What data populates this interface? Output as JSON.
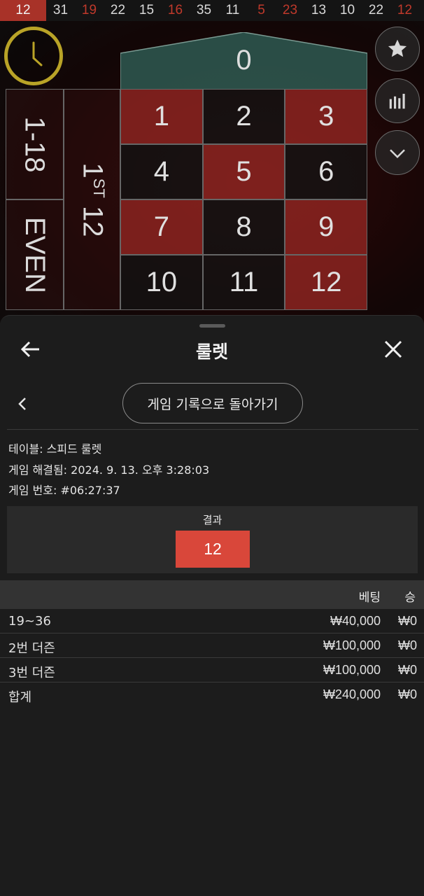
{
  "game_scene": {
    "history": [
      {
        "value": "12",
        "color": "red",
        "current": true
      },
      {
        "value": "31",
        "color": "black"
      },
      {
        "value": "19",
        "color": "red"
      },
      {
        "value": "22",
        "color": "black"
      },
      {
        "value": "15",
        "color": "black"
      },
      {
        "value": "16",
        "color": "red"
      },
      {
        "value": "35",
        "color": "black"
      },
      {
        "value": "11",
        "color": "black"
      },
      {
        "value": "5",
        "color": "red"
      },
      {
        "value": "23",
        "color": "red"
      },
      {
        "value": "13",
        "color": "black"
      },
      {
        "value": "10",
        "color": "black"
      },
      {
        "value": "22",
        "color": "black"
      },
      {
        "value": "12",
        "color": "red"
      }
    ],
    "zero_label": "0",
    "board": [
      {
        "n": "1",
        "color": "red"
      },
      {
        "n": "2",
        "color": "black"
      },
      {
        "n": "3",
        "color": "red"
      },
      {
        "n": "4",
        "color": "black"
      },
      {
        "n": "5",
        "color": "red"
      },
      {
        "n": "6",
        "color": "black"
      },
      {
        "n": "7",
        "color": "red"
      },
      {
        "n": "8",
        "color": "black"
      },
      {
        "n": "9",
        "color": "red"
      },
      {
        "n": "10",
        "color": "black"
      },
      {
        "n": "11",
        "color": "black"
      },
      {
        "n": "12",
        "color": "red"
      }
    ],
    "outside_bets": {
      "low": "1-18",
      "even": "EVEN",
      "dozen_number": "1",
      "dozen_suffix": "ST",
      "dozen_value": "12"
    },
    "side_buttons": [
      "star-icon",
      "statistics-icon",
      "chevron-down-icon"
    ],
    "colors": {
      "red": "#a83228",
      "timer": "#b9a327",
      "zero": "#2e5a52"
    }
  },
  "sheet": {
    "title": "룰렛",
    "history_button": "게임 기록으로 돌아가기",
    "table_label": "테이블:",
    "table_value": "스피드 룰렛",
    "resolved_label": "게임 해결됨:",
    "resolved_value": "2024. 9. 13. 오후 3:28:03",
    "game_id_label": "게임 번호:",
    "game_id_value": "#06:27:37",
    "result_label": "결과",
    "result_value": "12",
    "result_color": "#d9473a",
    "bets_header": {
      "bet": "베팅",
      "win": "승"
    },
    "bets": [
      {
        "name": "19~36",
        "amount": "₩40,000",
        "win": "₩0"
      },
      {
        "name": "2번 더즌",
        "amount": "₩100,000",
        "win": "₩0"
      },
      {
        "name": "3번 더즌",
        "amount": "₩100,000",
        "win": "₩0"
      }
    ],
    "total": {
      "name": "합계",
      "amount": "₩240,000",
      "win": "₩0"
    }
  }
}
